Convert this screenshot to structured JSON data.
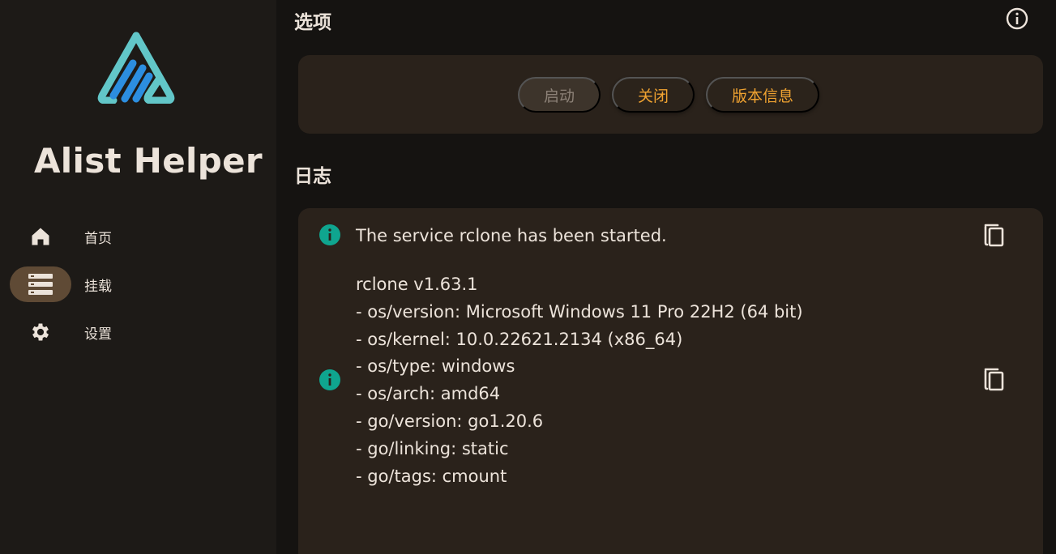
{
  "app": {
    "name": "Alist Helper",
    "colors": {
      "accent": "#f0a331",
      "info": "#0fa58f",
      "nav_active": "#5f4a35"
    }
  },
  "sidebar": {
    "items": [
      {
        "label": "首页",
        "icon": "home-icon",
        "active": false
      },
      {
        "label": "挂载",
        "icon": "storage-list-icon",
        "active": true
      },
      {
        "label": "设置",
        "icon": "gear-icon",
        "active": false
      }
    ]
  },
  "options": {
    "title": "选项",
    "buttons": [
      {
        "label": "启动",
        "enabled": false
      },
      {
        "label": "关闭",
        "enabled": true
      },
      {
        "label": "版本信息",
        "enabled": true
      }
    ]
  },
  "log": {
    "title": "日志",
    "entries": [
      {
        "level": "info",
        "text": "The service rclone has been started."
      },
      {
        "level": "info",
        "text": "rclone v1.63.1\n- os/version: Microsoft Windows 11 Pro 22H2 (64 bit)\n- os/kernel: 10.0.22621.2134 (x86_64)\n- os/type: windows\n- os/arch: amd64\n- go/version: go1.20.6\n- go/linking: static\n- go/tags: cmount"
      }
    ]
  }
}
